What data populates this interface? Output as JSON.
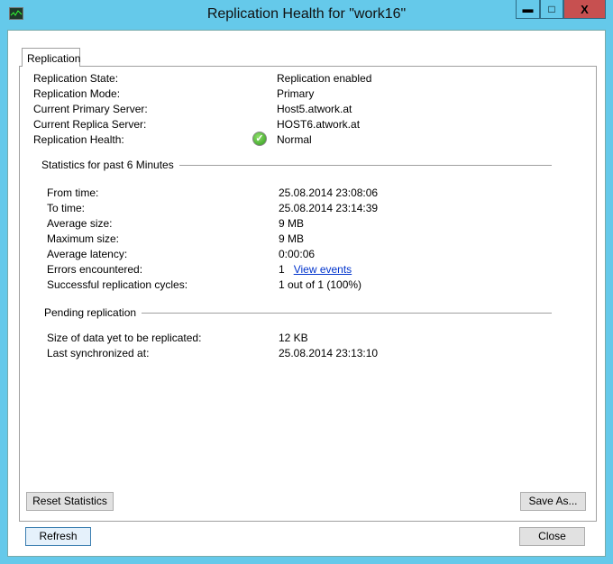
{
  "window": {
    "title": "Replication Health for \"work16\"",
    "minimize": "▬",
    "maximize": "□",
    "close": "X"
  },
  "tab": "Replication",
  "general": [
    {
      "label": "Replication State:",
      "value": "Replication enabled"
    },
    {
      "label": "Replication Mode:",
      "value": "Primary"
    },
    {
      "label": "Current Primary Server:",
      "value": "Host5.atwork.at"
    },
    {
      "label": "Current Replica Server:",
      "value": "HOST6.atwork.at"
    },
    {
      "label": "Replication Health:",
      "value": "Normal"
    }
  ],
  "stats": {
    "title": "Statistics for past 6 Minutes",
    "rows": [
      {
        "label": "From time:",
        "value": "25.08.2014 23:08:06"
      },
      {
        "label": "To time:",
        "value": "25.08.2014 23:14:39"
      },
      {
        "label": "Average size:",
        "value": "9 MB"
      },
      {
        "label": "Maximum size:",
        "value": "9 MB"
      },
      {
        "label": "Average latency:",
        "value": "0:00:06"
      },
      {
        "label": "Errors encountered:",
        "value": "1"
      },
      {
        "label": "Successful replication cycles:",
        "value": "1 out of 1 (100%)"
      }
    ],
    "view_events": "View events"
  },
  "pending": {
    "title": "Pending replication",
    "rows": [
      {
        "label": "Size of data yet to be replicated:",
        "value": "12 KB"
      },
      {
        "label": "Last synchronized at:",
        "value": "25.08.2014 23:13:10"
      }
    ]
  },
  "buttons": {
    "reset": "Reset Statistics",
    "save_as": "Save As...",
    "refresh": "Refresh",
    "close": "Close"
  }
}
